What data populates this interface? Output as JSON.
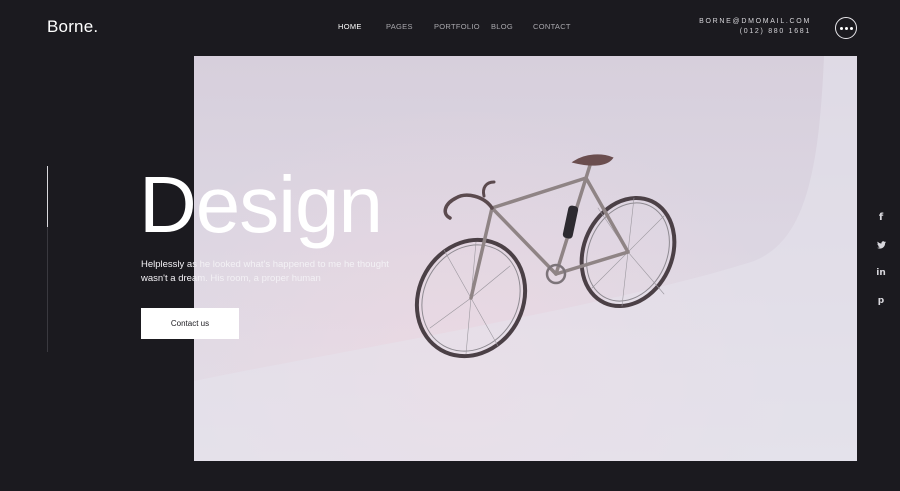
{
  "brand": {
    "logo": "Borne."
  },
  "nav": {
    "items": [
      {
        "label": "HOME",
        "active": true
      },
      {
        "label": "PAGES",
        "active": false
      },
      {
        "label": "PORTFOLIO",
        "active": false
      },
      {
        "label": "BLOG",
        "active": false
      },
      {
        "label": "CONTACT",
        "active": false
      }
    ]
  },
  "contact": {
    "email": "BORNE@DMOMAIL.COM",
    "phone": "(012) 880 1681"
  },
  "menu": {
    "icon": "more-horizontal-icon"
  },
  "hero": {
    "title": "Design",
    "subtitle_line1": "Helplessly as he looked what's happened to me he thought",
    "subtitle_line2": "wasn't a dream. His room, a proper human",
    "cta_label": "Contact us",
    "image_subject": "bicycle-icon"
  },
  "social": {
    "facebook": {
      "icon": "facebook-icon",
      "glyph": "f"
    },
    "twitter": {
      "icon": "twitter-icon",
      "glyph": "🐦"
    },
    "linkedin": {
      "icon": "linkedin-icon",
      "glyph": "in"
    },
    "pinterest": {
      "icon": "pinterest-icon",
      "glyph": "p"
    }
  },
  "colors": {
    "background": "#1b1a1f",
    "text": "#ffffff",
    "nav_inactive": "#a9a8ad",
    "hero_bg": "#dcd6e2",
    "cta_bg": "#ffffff",
    "cta_text": "#1b1a1f"
  }
}
